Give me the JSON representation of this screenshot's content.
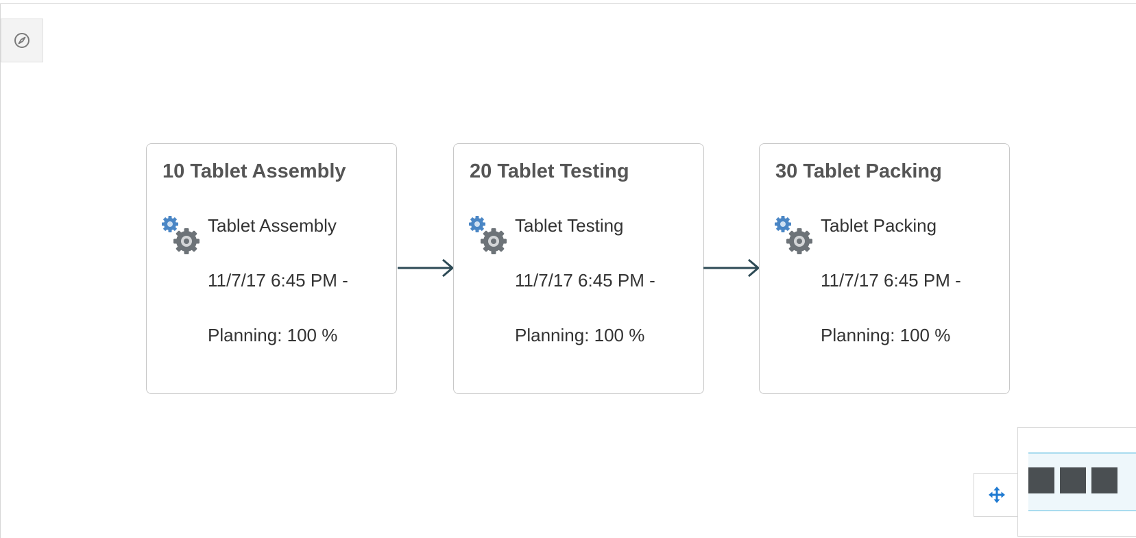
{
  "nodes": [
    {
      "title": "10 Tablet Assembly",
      "operation": "Tablet Assembly",
      "date": "11/7/17 6:45 PM -",
      "planning": "Planning: 100 %"
    },
    {
      "title": "20 Tablet Testing",
      "operation": "Tablet Testing",
      "date": "11/7/17 6:45 PM -",
      "planning": "Planning: 100 %"
    },
    {
      "title": "30 Tablet Packing",
      "operation": "Tablet Packing",
      "date": "11/7/17 6:45 PM -",
      "planning": "Planning: 100 %"
    }
  ],
  "icons": {
    "compass": "compass-icon",
    "operation": "gears-icon",
    "pan": "move-arrows-icon"
  },
  "colors": {
    "node_border": "#c8c8c8",
    "title_text": "#555555",
    "arrow": "#2d4a55",
    "gear_blue": "#4a86c5",
    "gear_gray": "#6d7378",
    "pan_icon": "#1f7ad1",
    "mini_node": "#4a4f52",
    "overview_highlight": "#a9dcef"
  }
}
